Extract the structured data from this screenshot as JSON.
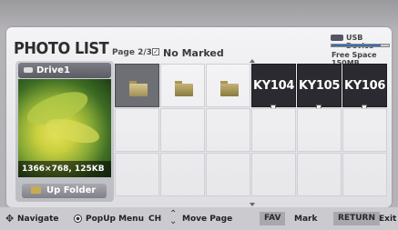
{
  "header": {
    "title": "PHOTO LIST",
    "page_indicator": "Page 2/3",
    "mark_status": "No Marked",
    "usb_label": "USB Device",
    "free_space": "Free Space 150MB",
    "usb_usage_fraction": 0.85
  },
  "preview": {
    "drive_label": "Drive1",
    "image_info": "1366×768, 125KB",
    "up_folder_label": "Up Folder"
  },
  "grid": {
    "items": [
      {
        "type": "folder",
        "label": "",
        "selected": true
      },
      {
        "type": "folder",
        "label": ""
      },
      {
        "type": "folder",
        "label": ""
      },
      {
        "type": "file",
        "label": "KY104"
      },
      {
        "type": "file",
        "label": "KY105"
      },
      {
        "type": "file",
        "label": "KY106"
      }
    ]
  },
  "footer": {
    "navigate": "Navigate",
    "popup_menu": "PopUp Menu",
    "ch": "CH",
    "move_page": "Move Page",
    "fav_key": "FAV",
    "mark": "Mark",
    "return_key": "RETURN",
    "exit": "Exit"
  },
  "colors": {
    "selected_cell": "#6e6f75",
    "file_cell": "#2a2a30",
    "accent_bar": "#3a6bb0"
  }
}
